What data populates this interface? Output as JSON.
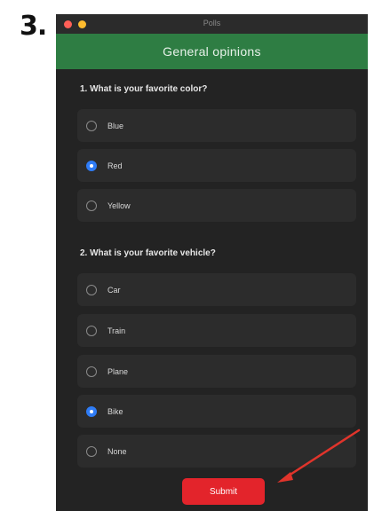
{
  "step_label": "3.",
  "window": {
    "title": "Polls",
    "banner_title": "General opinions"
  },
  "questions": [
    {
      "text": "1. What is your favorite color?",
      "options": [
        {
          "label": "Blue",
          "selected": false
        },
        {
          "label": "Red",
          "selected": true
        },
        {
          "label": "Yellow",
          "selected": false
        }
      ]
    },
    {
      "text": "2. What is your favorite vehicle?",
      "options": [
        {
          "label": "Car",
          "selected": false
        },
        {
          "label": "Train",
          "selected": false
        },
        {
          "label": "Plane",
          "selected": false
        },
        {
          "label": "Bike",
          "selected": true
        },
        {
          "label": "None",
          "selected": false
        }
      ]
    }
  ],
  "submit_label": "Submit",
  "colors": {
    "banner": "#2e7d43",
    "window_bg": "#232323",
    "option_bg": "#2c2c2c",
    "radio_selected": "#2f7cf6",
    "submit": "#e3242b",
    "arrow": "#e0342b"
  },
  "icons": {
    "window_close": "red-circle-icon",
    "window_minimize": "yellow-circle-icon",
    "annotation_arrow": "red-arrow-icon"
  }
}
